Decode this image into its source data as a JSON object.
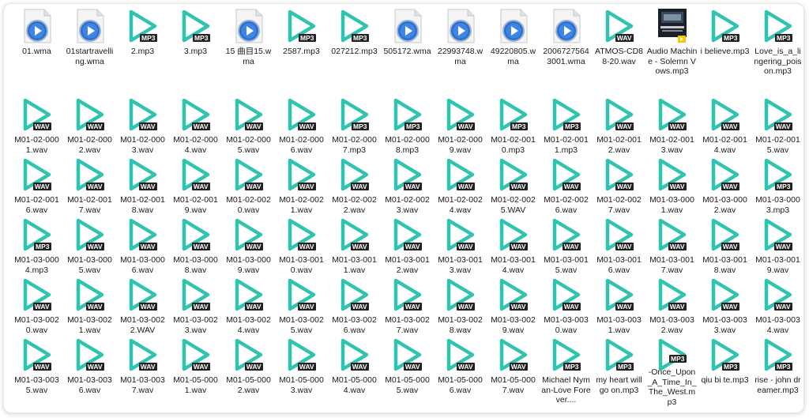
{
  "colors": {
    "play_accent": "#2ec4b0",
    "wma_blue": "#2f6fc9",
    "badge_bg": "#222222"
  },
  "files": [
    {
      "label": "01.wma",
      "kind": "wma"
    },
    {
      "label": "01startravelling.wma",
      "kind": "wma"
    },
    {
      "label": "2.mp3",
      "kind": "mp3"
    },
    {
      "label": "3.mp3",
      "kind": "mp3"
    },
    {
      "label": "15 曲目15.wma",
      "kind": "wma"
    },
    {
      "label": "2587.mp3",
      "kind": "mp3"
    },
    {
      "label": "027212.mp3",
      "kind": "mp3"
    },
    {
      "label": "505172.wma",
      "kind": "wma"
    },
    {
      "label": "22993748.wma",
      "kind": "wma"
    },
    {
      "label": "49220805.wma",
      "kind": "wma"
    },
    {
      "label": "20067275643001.wma",
      "kind": "wma"
    },
    {
      "label": "ATMOS-CD88-20.wav",
      "kind": "wav"
    },
    {
      "label": "Audio Machine - Solemn Vows.mp3",
      "kind": "album"
    },
    {
      "label": "i believe.mp3",
      "kind": "mp3"
    },
    {
      "label": "Love_is_a_lingering_poison.mp3",
      "kind": "mp3"
    },
    {
      "label": "M01-02-0001.wav",
      "kind": "wav"
    },
    {
      "label": "M01-02-0002.wav",
      "kind": "wav"
    },
    {
      "label": "M01-02-0003.wav",
      "kind": "wav"
    },
    {
      "label": "M01-02-0004.wav",
      "kind": "wav"
    },
    {
      "label": "M01-02-0005.wav",
      "kind": "wav"
    },
    {
      "label": "M01-02-0006.wav",
      "kind": "wav"
    },
    {
      "label": "M01-02-0007.mp3",
      "kind": "mp3"
    },
    {
      "label": "M01-02-0008.mp3",
      "kind": "mp3"
    },
    {
      "label": "M01-02-0009.wav",
      "kind": "wav"
    },
    {
      "label": "M01-02-0010.mp3",
      "kind": "mp3"
    },
    {
      "label": "M01-02-0011.mp3",
      "kind": "mp3"
    },
    {
      "label": "M01-02-0012.wav",
      "kind": "wav"
    },
    {
      "label": "M01-02-0013.wav",
      "kind": "wav"
    },
    {
      "label": "M01-02-0014.wav",
      "kind": "wav"
    },
    {
      "label": "M01-02-0015.wav",
      "kind": "wav"
    },
    {
      "label": "M01-02-0016.wav",
      "kind": "wav"
    },
    {
      "label": "M01-02-0017.wav",
      "kind": "wav"
    },
    {
      "label": "M01-02-0018.wav",
      "kind": "wav"
    },
    {
      "label": "M01-02-0019.wav",
      "kind": "wav"
    },
    {
      "label": "M01-02-0020.wav",
      "kind": "wav"
    },
    {
      "label": "M01-02-0021.wav",
      "kind": "wav"
    },
    {
      "label": "M01-02-0022.wav",
      "kind": "wav"
    },
    {
      "label": "M01-02-0023.wav",
      "kind": "wav"
    },
    {
      "label": "M01-02-0024.wav",
      "kind": "wav"
    },
    {
      "label": "M01-02-0025.WAV",
      "kind": "wav"
    },
    {
      "label": "M01-02-0026.wav",
      "kind": "wav"
    },
    {
      "label": "M01-02-0027.wav",
      "kind": "wav"
    },
    {
      "label": "M01-03-0001.wav",
      "kind": "wav"
    },
    {
      "label": "M01-03-0002.wav",
      "kind": "wav"
    },
    {
      "label": "M01-03-0003.mp3",
      "kind": "mp3"
    },
    {
      "label": "M01-03-0004.mp3",
      "kind": "mp3"
    },
    {
      "label": "M01-03-0005.wav",
      "kind": "wav"
    },
    {
      "label": "M01-03-0006.wav",
      "kind": "wav"
    },
    {
      "label": "M01-03-0008.wav",
      "kind": "wav"
    },
    {
      "label": "M01-03-0009.wav",
      "kind": "wav"
    },
    {
      "label": "M01-03-0010.wav",
      "kind": "wav"
    },
    {
      "label": "M01-03-0011.wav",
      "kind": "wav"
    },
    {
      "label": "M01-03-0012.wav",
      "kind": "wav"
    },
    {
      "label": "M01-03-0013.wav",
      "kind": "wav"
    },
    {
      "label": "M01-03-0014.wav",
      "kind": "wav"
    },
    {
      "label": "M01-03-0015.wav",
      "kind": "wav"
    },
    {
      "label": "M01-03-0016.wav",
      "kind": "wav"
    },
    {
      "label": "M01-03-0017.wav",
      "kind": "wav"
    },
    {
      "label": "M01-03-0018.wav",
      "kind": "wav"
    },
    {
      "label": "M01-03-0019.wav",
      "kind": "wav"
    },
    {
      "label": "M01-03-0020.wav",
      "kind": "wav"
    },
    {
      "label": "M01-03-0021.wav",
      "kind": "wav"
    },
    {
      "label": "M01-03-0022.WAV",
      "kind": "wav"
    },
    {
      "label": "M01-03-0023.wav",
      "kind": "wav"
    },
    {
      "label": "M01-03-0024.wav",
      "kind": "wav"
    },
    {
      "label": "M01-03-0025.wav",
      "kind": "wav"
    },
    {
      "label": "M01-03-0026.wav",
      "kind": "wav"
    },
    {
      "label": "M01-03-0027.wav",
      "kind": "wav"
    },
    {
      "label": "M01-03-0028.wav",
      "kind": "wav"
    },
    {
      "label": "M01-03-0029.wav",
      "kind": "wav"
    },
    {
      "label": "M01-03-0030.wav",
      "kind": "wav"
    },
    {
      "label": "M01-03-0031.wav",
      "kind": "wav"
    },
    {
      "label": "M01-03-0032.wav",
      "kind": "wav"
    },
    {
      "label": "M01-03-0033.wav",
      "kind": "wav"
    },
    {
      "label": "M01-03-0034.wav",
      "kind": "wav"
    },
    {
      "label": "M01-03-0035.wav",
      "kind": "wav"
    },
    {
      "label": "M01-03-0036.wav",
      "kind": "wav"
    },
    {
      "label": "M01-03-0037.wav",
      "kind": "wav"
    },
    {
      "label": "M01-05-0001.wav",
      "kind": "wav"
    },
    {
      "label": "M01-05-0002.wav",
      "kind": "wav"
    },
    {
      "label": "M01-05-0003.wav",
      "kind": "wav"
    },
    {
      "label": "M01-05-0004.wav",
      "kind": "wav"
    },
    {
      "label": "M01-05-0005.wav",
      "kind": "wav"
    },
    {
      "label": "M01-05-0006.wav",
      "kind": "wav"
    },
    {
      "label": "M01-05-0007.wav",
      "kind": "wav"
    },
    {
      "label": "Michael Nyman-Love Forever....",
      "kind": "mp3"
    },
    {
      "label": "my heart will go on.mp3",
      "kind": "mp3"
    },
    {
      "label": "-Once_Upon_A_Time_In_The_West.mp3",
      "kind": "mp3"
    },
    {
      "label": "qiu bi te.mp3",
      "kind": "mp3"
    },
    {
      "label": "rise - john dreamer.mp3",
      "kind": "mp3"
    }
  ],
  "badges": {
    "mp3": "MP3",
    "wav": "WAV"
  }
}
